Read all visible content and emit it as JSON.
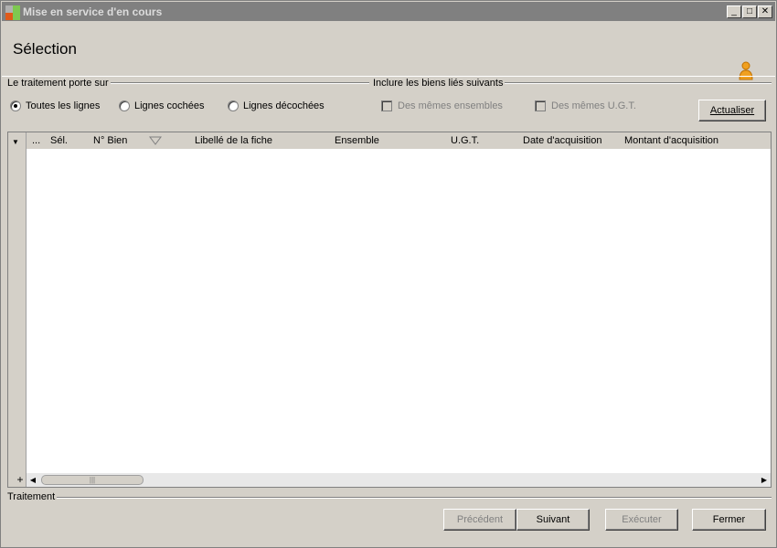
{
  "window": {
    "title": "Mise en service d'en cours",
    "minimize": "_",
    "maximize": "□",
    "close": "✕"
  },
  "header": {
    "title": "Sélection",
    "user_icon": "user-icon"
  },
  "treatment_group": {
    "label": "Le traitement porte sur",
    "options": [
      {
        "label": "Toutes les lignes",
        "checked": true
      },
      {
        "label": "Lignes cochées",
        "checked": false
      },
      {
        "label": "Lignes décochées",
        "checked": false
      }
    ]
  },
  "linked_group": {
    "label": "Inclure les biens liés suivants",
    "options": [
      {
        "label": "Des mêmes ensembles",
        "checked": false,
        "disabled": true
      },
      {
        "label": "Des mêmes U.G.T.",
        "checked": false,
        "disabled": true
      }
    ]
  },
  "actualiser_label": "Actualiser",
  "grid": {
    "columns": [
      "...",
      "Sél.",
      "N° Bien",
      "Libellé de la fiche",
      "Ensemble",
      "U.G.T.",
      "Date d'acquisition",
      "Montant d'acquisition"
    ],
    "rows": []
  },
  "footer": {
    "group_label": "Traitement",
    "buttons": {
      "previous": "Précédent",
      "next": "Suivant",
      "execute": "Exécuter",
      "close": "Fermer"
    }
  }
}
